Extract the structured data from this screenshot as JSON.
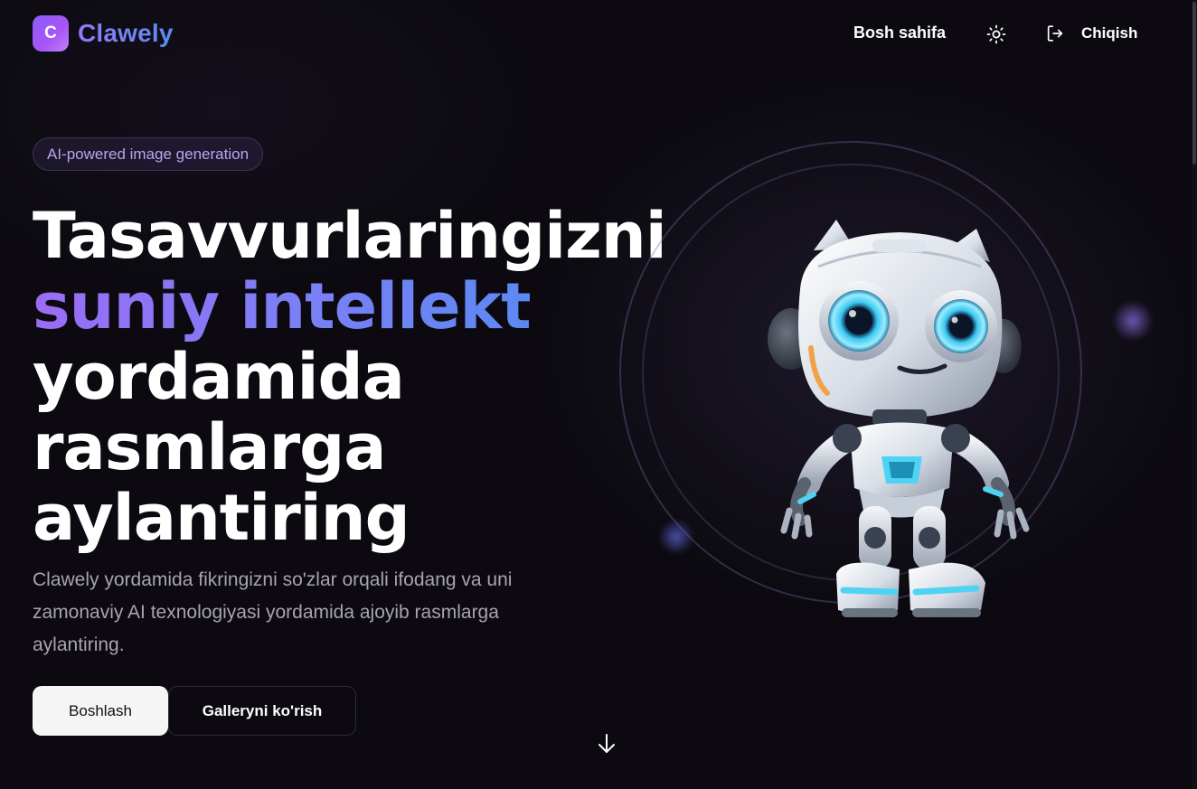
{
  "header": {
    "logo_letter": "C",
    "brand": "Clawely",
    "nav_home": "Bosh sahifa",
    "logout_label": "Chiqish"
  },
  "hero": {
    "badge": "AI-powered image generation",
    "headline": {
      "line1": "Tasavvurlaringizni",
      "line2_accent": "suniy intellekt",
      "line3": "yordamida",
      "line4": "rasmlarga",
      "line5": "aylantiring"
    },
    "description": "Clawely yordamida fikringizni so'zlar orqali ifodang va uni zamonaviy AI texnologiyasi yordamida ajoyib rasmlarga aylantiring.",
    "primary_button": "Boshlash",
    "secondary_button": "Galleryni ko'rish"
  },
  "icons": {
    "theme_toggle": "sun-icon",
    "logout": "logout-icon",
    "scroll_down": "arrow-down-icon"
  },
  "colors": {
    "background": "#0c0a10",
    "accent_start": "#9b6cf5",
    "accent_end": "#4f8cf1",
    "logo_badge": "#a855f7",
    "muted_text": "#a7a3b0"
  }
}
